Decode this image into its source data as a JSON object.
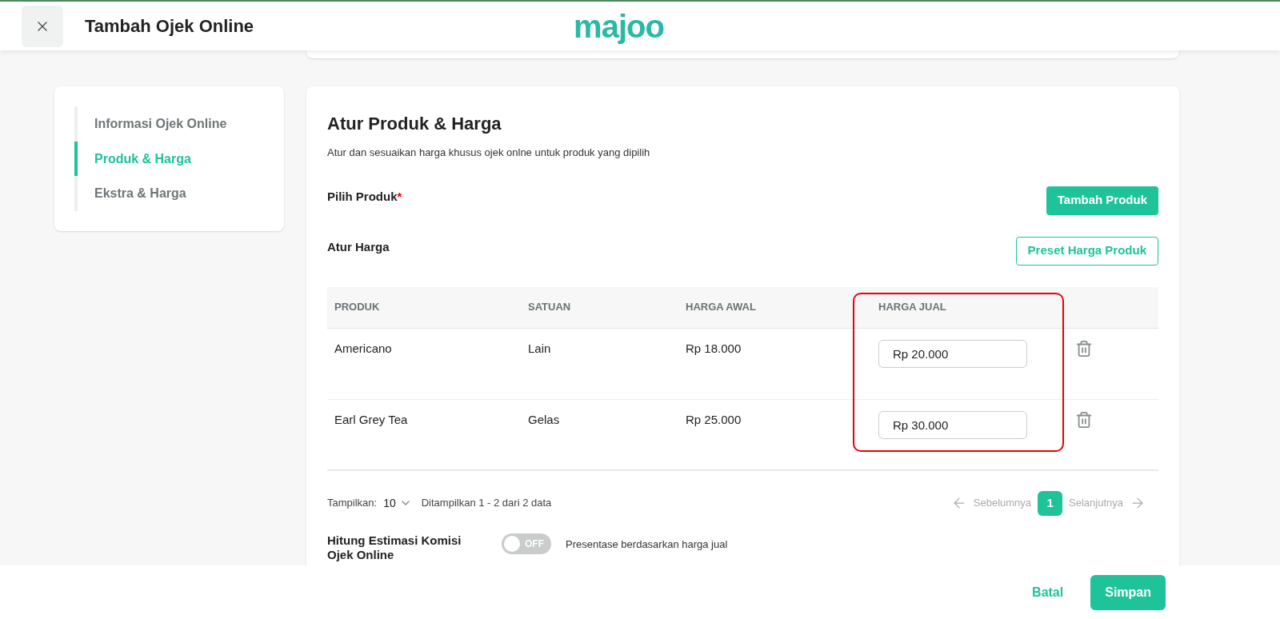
{
  "header": {
    "title": "Tambah Ojek Online",
    "logo": "majoo"
  },
  "steps": [
    {
      "label": "Informasi Ojek Online",
      "selected": false
    },
    {
      "label": "Produk & Harga",
      "selected": true
    },
    {
      "label": "Ekstra & Harga",
      "selected": false
    }
  ],
  "section": {
    "title": "Atur Produk & Harga",
    "subtitle": "Atur dan sesuaikan harga khusus ojek onlne untuk produk yang dipilih"
  },
  "pick_product": {
    "label": "Pilih Produk",
    "required_mark": "*",
    "button": "Tambah Produk"
  },
  "set_price": {
    "label": "Atur Harga",
    "button": "Preset Harga Produk"
  },
  "table": {
    "columns": [
      {
        "label": "PRODUK",
        "highlighted": false
      },
      {
        "label": "SATUAN",
        "highlighted": false
      },
      {
        "label": "HARGA AWAL",
        "highlighted": false
      },
      {
        "label": "HARGA JUAL",
        "highlighted": true
      }
    ],
    "rows": [
      {
        "product": "Americano",
        "unit": "Lain",
        "base_price": "Rp 18.000",
        "sell_price": "Rp 20.000"
      },
      {
        "product": "Earl Grey Tea",
        "unit": "Gelas",
        "base_price": "Rp 25.000",
        "sell_price": "Rp 30.000"
      }
    ]
  },
  "pagination": {
    "show_label": "Tampilkan:",
    "page_size": "10",
    "summary": "Ditampilkan 1 - 2 dari 2 data",
    "prev": "Sebelumnya",
    "pages": [
      {
        "label": "1",
        "selected": true
      }
    ],
    "next": "Selanjutnya"
  },
  "commission": {
    "label": "Hitung Estimasi Komisi Ojek Online",
    "on": false,
    "toggle_text": "OFF",
    "description": "Presentase berdasarkan harga jual"
  },
  "footer": {
    "cancel": "Batal",
    "save": "Simpan"
  }
}
